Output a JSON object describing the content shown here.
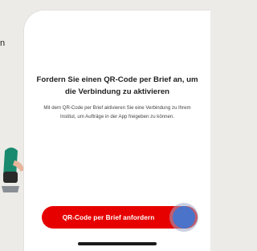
{
  "background": {
    "text_fragment": "n"
  },
  "screen": {
    "title": "Fordern Sie einen QR-Code per Brief an, um die Verbindung zu aktivieren",
    "description": "Mit dem QR-Code per Brief aktivieren Sie eine Verbindung zu Ihrem Institut, um Aufträge in der App freigeben zu können.",
    "cta_label": "QR-Code per Brief anfordern"
  },
  "colors": {
    "accent": "#e60000",
    "touch_indicator": "#4a73c9",
    "page_background": "#edebe7"
  }
}
